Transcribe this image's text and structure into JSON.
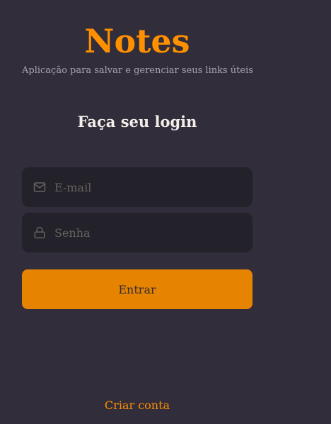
{
  "header": {
    "app_title": "Notes",
    "app_subtitle": "Aplicação para salvar e gerenciar seus links úteis"
  },
  "form": {
    "heading": "Faça seu login",
    "email": {
      "placeholder": "E-mail",
      "value": "",
      "icon": "mail-icon"
    },
    "password": {
      "placeholder": "Senha",
      "value": "",
      "icon": "lock-icon"
    },
    "submit_label": "Entrar"
  },
  "footer": {
    "create_account_label": "Criar conta"
  },
  "colors": {
    "background": "#312d3a",
    "input_background": "#232129",
    "accent": "#ff9000",
    "button": "#e68300",
    "heading_text": "#f4ede8",
    "subtitle_text": "#a8a5b0",
    "placeholder_text": "#666360"
  }
}
